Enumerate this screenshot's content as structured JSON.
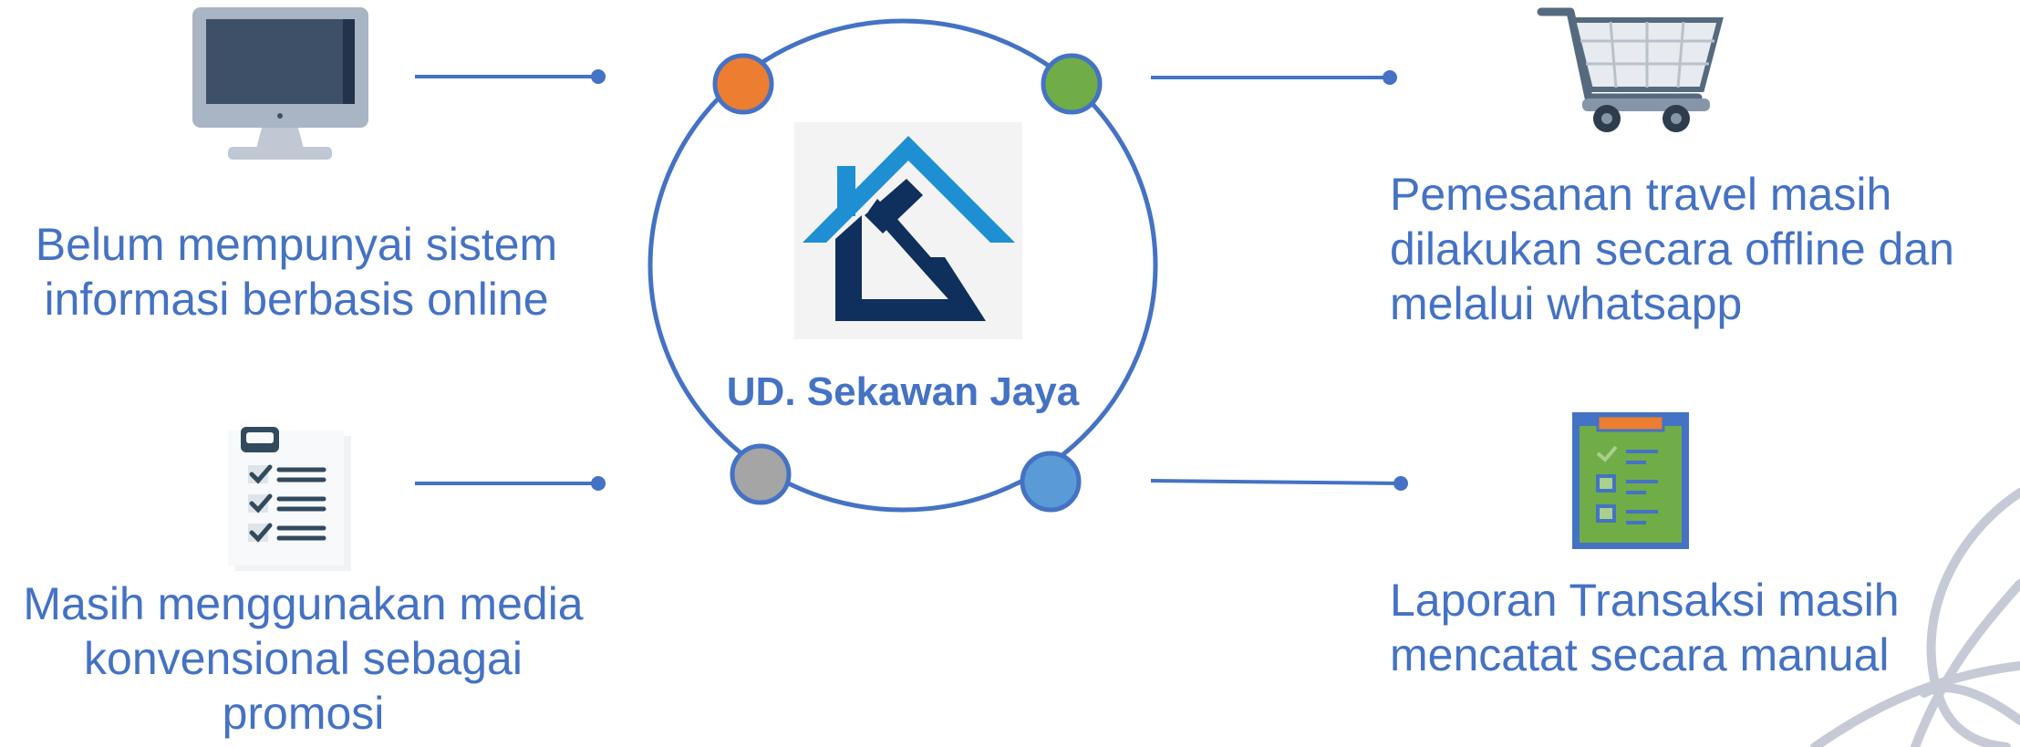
{
  "colors": {
    "primary": "#4472c4",
    "text": "#4472c4",
    "dot_orange": "#ed7d31",
    "dot_green": "#70ad47",
    "dot_gray": "#a5a5a5",
    "dot_blue": "#5b9bd5",
    "logo_light": "#1e8fd2",
    "logo_dark": "#0f2f5c",
    "decoration": "#c5cad6"
  },
  "center": {
    "title": "UD. Sekawan Jaya",
    "logo_icon": "house-hammer-logo"
  },
  "items": {
    "top_left": {
      "icon": "monitor-icon",
      "lines": [
        "Belum mempunyai sistem",
        "informasi berbasis online"
      ]
    },
    "bottom_left": {
      "icon": "checklist-icon",
      "lines": [
        "Masih menggunakan media",
        "konvensional sebagai",
        "promosi"
      ]
    },
    "top_right": {
      "icon": "shopping-cart-icon",
      "lines": [
        "Pemesanan travel masih",
        "dilakukan secara offline dan",
        "melalui whatsapp"
      ]
    },
    "bottom_right": {
      "icon": "report-clipboard-icon",
      "lines": [
        "Laporan Transaksi masih",
        "mencatat secara manual"
      ]
    }
  }
}
